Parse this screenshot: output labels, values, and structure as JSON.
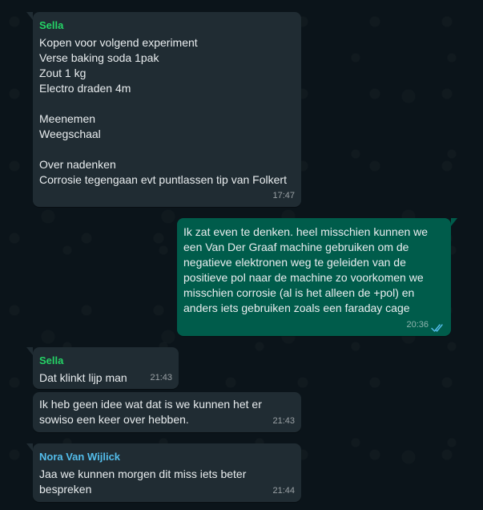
{
  "chat": {
    "messages": [
      {
        "sender": "Sella",
        "lines": [
          "Kopen voor volgend experiment",
          "Verse baking soda 1pak",
          "Zout 1 kg",
          "Electro draden 4m",
          "",
          "Meenemen",
          "Weegschaal",
          "",
          "Over nadenken",
          "Corrosie tegengaan evt puntlassen tip van Folkert"
        ],
        "time": "17:47"
      },
      {
        "lines": [
          "Ik zat even te denken. heel misschien kunnen we",
          "een Van Der Graaf machine gebruiken om de",
          "negatieve elektronen weg te geleiden van de",
          "positieve pol naar de machine zo voorkomen we",
          "misschien corrosie (al is het alleen de +pol) en",
          "anders iets gebruiken zoals een faraday cage"
        ],
        "time": "20:36",
        "status_icon": "double-check-read-icon"
      },
      {
        "sender": "Sella",
        "lines": [
          "Dat klinkt lijp man"
        ],
        "time": "21:43"
      },
      {
        "lines": [
          "Ik heb geen idee wat dat is we kunnen het er",
          "sowiso een keer over hebben."
        ],
        "time": "21:43"
      },
      {
        "sender": "Nora Van Wijlick",
        "lines": [
          "Jaa we kunnen morgen dit miss iets beter",
          "bespreken"
        ],
        "time": "21:44"
      }
    ]
  },
  "colors": {
    "background": "#0b141a",
    "incoming_bubble": "#202c33",
    "outgoing_bubble": "#005c4b",
    "sender_green": "#25d366",
    "sender_blue": "#53bdeb",
    "read_ticks": "#53bdeb"
  }
}
